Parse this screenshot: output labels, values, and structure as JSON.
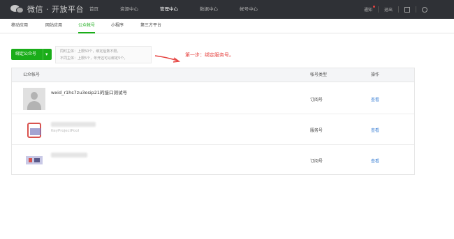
{
  "top_nav": {
    "brand": "微信 · 开放平台",
    "items": [
      "首页",
      "资源中心",
      "管理中心",
      "数据中心",
      "帐号中心"
    ],
    "active_index": 2,
    "notifications": "通知",
    "logout": "退出"
  },
  "sub_nav": {
    "tabs": [
      "移动应用",
      "网站应用",
      "公众帐号",
      "小程序",
      "第三方平台"
    ],
    "active_index": 2
  },
  "actions": {
    "bind_button": "绑定公众号",
    "notice_line1": "同时主体：上限50个，绑定后数不限。",
    "notice_line2": "不同主体：上限5个，年开还可以绑定5个。",
    "step_note": "第一步：绑定服务号。"
  },
  "table": {
    "headers": {
      "account": "公众帐号",
      "type": "帐号类型",
      "action": "操作"
    },
    "rows": [
      {
        "name": "wxid_r1hs7zu3osip21的接口测试号",
        "sub": "",
        "type": "订阅号",
        "action": "查看"
      },
      {
        "name": "",
        "sub": "KeyProjectPool",
        "type": "服务号",
        "action": "查看"
      },
      {
        "name": "",
        "sub": "",
        "type": "订阅号",
        "action": "查看"
      }
    ]
  },
  "colors": {
    "accent": "#1aad19",
    "link": "#3a7fd5",
    "note": "#e64340",
    "topbar": "#2f3136"
  }
}
